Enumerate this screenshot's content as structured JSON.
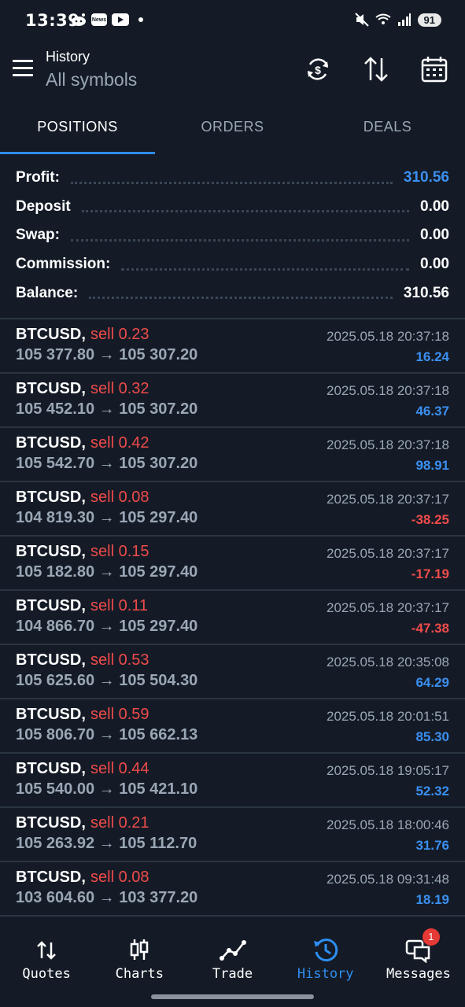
{
  "status": {
    "time": "13:39",
    "battery": "91",
    "news_label": "News"
  },
  "header": {
    "title": "History",
    "subtitle": "All symbols"
  },
  "tabs": [
    {
      "label": "POSITIONS"
    },
    {
      "label": "ORDERS"
    },
    {
      "label": "DEALS"
    }
  ],
  "summary": {
    "profit": {
      "label": "Profit:",
      "value": "310.56"
    },
    "deposit": {
      "label": "Deposit",
      "value": "0.00"
    },
    "swap": {
      "label": "Swap:",
      "value": "0.00"
    },
    "commission": {
      "label": "Commission:",
      "value": "0.00"
    },
    "balance": {
      "label": "Balance:",
      "value": "310.56"
    }
  },
  "positions": [
    {
      "symbol": "BTCUSD,",
      "side": "sell 0.23",
      "prices": "105 377.80 → 105 307.20",
      "datetime": "2025.05.18 20:37:18",
      "profit": "16.24",
      "sign": "pos"
    },
    {
      "symbol": "BTCUSD,",
      "side": "sell 0.32",
      "prices": "105 452.10 → 105 307.20",
      "datetime": "2025.05.18 20:37:18",
      "profit": "46.37",
      "sign": "pos"
    },
    {
      "symbol": "BTCUSD,",
      "side": "sell 0.42",
      "prices": "105 542.70 → 105 307.20",
      "datetime": "2025.05.18 20:37:18",
      "profit": "98.91",
      "sign": "pos"
    },
    {
      "symbol": "BTCUSD,",
      "side": "sell 0.08",
      "prices": "104 819.30 → 105 297.40",
      "datetime": "2025.05.18 20:37:17",
      "profit": "-38.25",
      "sign": "neg"
    },
    {
      "symbol": "BTCUSD,",
      "side": "sell 0.15",
      "prices": "105 182.80 → 105 297.40",
      "datetime": "2025.05.18 20:37:17",
      "profit": "-17.19",
      "sign": "neg"
    },
    {
      "symbol": "BTCUSD,",
      "side": "sell 0.11",
      "prices": "104 866.70 → 105 297.40",
      "datetime": "2025.05.18 20:37:17",
      "profit": "-47.38",
      "sign": "neg"
    },
    {
      "symbol": "BTCUSD,",
      "side": "sell 0.53",
      "prices": "105 625.60 → 105 504.30",
      "datetime": "2025.05.18 20:35:08",
      "profit": "64.29",
      "sign": "pos"
    },
    {
      "symbol": "BTCUSD,",
      "side": "sell 0.59",
      "prices": "105 806.70 → 105 662.13",
      "datetime": "2025.05.18 20:01:51",
      "profit": "85.30",
      "sign": "pos"
    },
    {
      "symbol": "BTCUSD,",
      "side": "sell 0.44",
      "prices": "105 540.00 → 105 421.10",
      "datetime": "2025.05.18 19:05:17",
      "profit": "52.32",
      "sign": "pos"
    },
    {
      "symbol": "BTCUSD,",
      "side": "sell 0.21",
      "prices": "105 263.92 → 105 112.70",
      "datetime": "2025.05.18 18:00:46",
      "profit": "31.76",
      "sign": "pos"
    },
    {
      "symbol": "BTCUSD,",
      "side": "sell 0.08",
      "prices": "103 604.60 → 103 377.20",
      "datetime": "2025.05.18 09:31:48",
      "profit": "18.19",
      "sign": "pos"
    }
  ],
  "nav": [
    {
      "label": "Quotes"
    },
    {
      "label": "Charts"
    },
    {
      "label": "Trade"
    },
    {
      "label": "History"
    },
    {
      "label": "Messages",
      "badge": "1"
    }
  ],
  "colors": {
    "background": "#141b26",
    "accent": "#2e8ef0",
    "profit_positive": "#3b8ff0",
    "profit_negative": "#ef4b4b",
    "muted_text": "#9aa6b5"
  }
}
